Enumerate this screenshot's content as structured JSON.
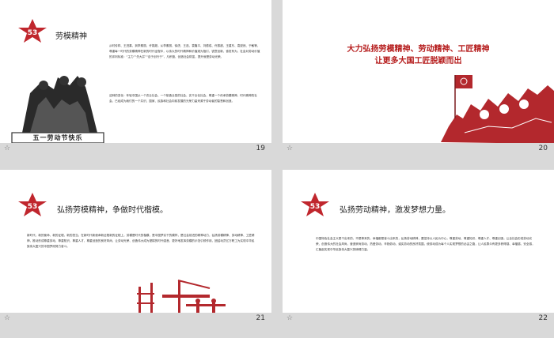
{
  "colors": {
    "accent": "#c0262d",
    "footer": "#d9d9d9"
  },
  "slides": [
    {
      "title": "劳模精神",
      "badge_text": "53",
      "body_text": "从时传祥、王进喜，到李素丽、许振超，从李素丽、徐虎、王选、袁隆平、刘德成、许振超、王建东、袁锐然、于敏等，尊重每一时代的劳模精神在新的时代征程中，以伟大的时代精神和价值观为指引，锐意创新、奋发有为，社会对劳动价值的评判标准：“主力”“先大并”“自于创行于”，凡积极、创造社会财富，提升就是劳动光荣。",
      "body_text2": "这种的变化：年轻中国从一个农业社会、一个制造业型的社会、实干业化社会，尊重一个传承劳模精神、时代精神的社会，已经成为我们的一个共识，国家、民族和社会向前发展的光荣力量来源于劳动者的智慧和创造。",
      "banner_text": "五一劳动节快乐",
      "page": "19"
    },
    {
      "heading_line1": "大力弘扬劳模精神、劳动精神、工匠精神",
      "heading_line2": "让更多大国工匠脱颖而出",
      "page": "20"
    },
    {
      "title": "弘扬劳模精神，争做时代楷模。",
      "badge_text": "53",
      "body_text": "新时代、新的使命，新的征程，新的担当，在新时代新使命新征程新的征程上，劳模是时代的楷模，是中国梦实干的模样，是社会前进的精神动力，弘扬劳模精神、劳动精神、工匠精神，推动形成尊重劳动、尊重知识、尊重人才、尊重创造的良好风尚，让劳动光荣、创造伟大成为铿锵的时代强音，更好地发挥劳模的示范引领作用，团结动员亿万职工为实现中华民族伟大复兴的中国梦而努力奋斗。",
      "page": "21"
    },
    {
      "title": "弘扬劳动精神，激发梦想力量。",
      "badge_text": "53",
      "body_text": "中国特色社会主义是干出来的，不是等来的，幸福都是奋斗出来的，弘扬劳动精神，要坚持以人民为中心，尊重劳动、尊重知识、尊重人才、尊重创造，让全社会形成劳动光荣、创造伟大的社会风尚，营造崇尚劳动、热爱劳动、辛勤劳动、诚实劳动的良好氛围，使劳动成为每个人实现梦想的必由之路，让人民群众有更多获得感、幸福感、安全感，汇聚起实现中华民族伟大复兴的磅礴力量。",
      "page": "22"
    }
  ]
}
